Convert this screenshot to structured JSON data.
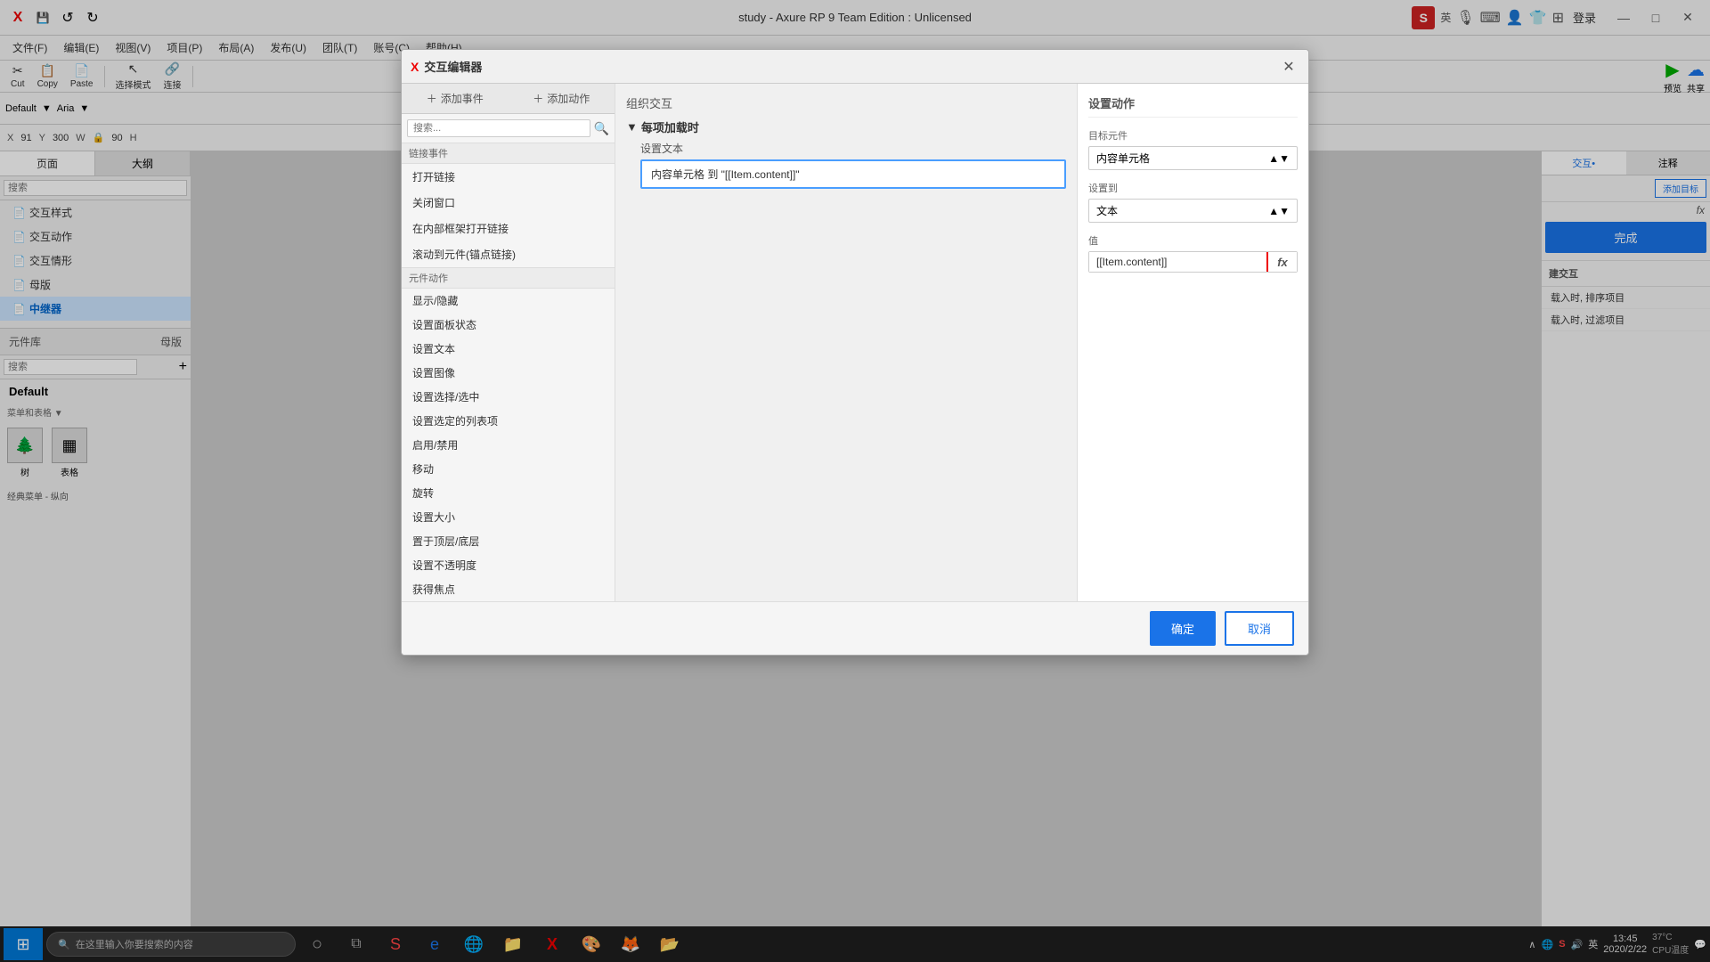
{
  "app": {
    "title": "study - Axure RP 9 Team Edition : Unlicensed",
    "title_icon": "X"
  },
  "titlebar": {
    "save_icon": "💾",
    "undo_icon": "↺",
    "redo_icon": "↻",
    "close_btn": "✕",
    "maximize_btn": "□",
    "minimize_btn": "—"
  },
  "menubar": {
    "items": [
      {
        "label": "文件(F)"
      },
      {
        "label": "编辑(E)"
      },
      {
        "label": "视图(V)"
      },
      {
        "label": "项目(P)"
      },
      {
        "label": "布局(A)"
      },
      {
        "label": "发布(U)"
      },
      {
        "label": "团队(T)"
      },
      {
        "label": "账号(C)"
      },
      {
        "label": "帮助(H)"
      }
    ]
  },
  "toolbar": {
    "cut_label": "Cut",
    "copy_label": "Copy",
    "paste_label": "Paste",
    "select_mode_label": "选择模式",
    "connect_label": "连接"
  },
  "format_bar": {
    "font": "Default",
    "font_face": "Aria"
  },
  "property_bar": {
    "x": "91",
    "y": "300",
    "w": "90",
    "h": ""
  },
  "left_panel": {
    "tab1": "页面",
    "tab2": "大纲",
    "items": [
      {
        "label": "交互样式"
      },
      {
        "label": "交互动作"
      },
      {
        "label": "交互情形"
      },
      {
        "label": "母版"
      },
      {
        "label": "中继器",
        "active": true
      }
    ],
    "library_title": "元件库",
    "library_subtitle": "母版",
    "default_label": "Default",
    "tree_label": "树",
    "table_label": "表格",
    "classic_menu_label": "经典菜单 - 纵向"
  },
  "right_panel": {
    "tab_interact": "交互•",
    "tab_notes": "注释",
    "interact_section": "建交互",
    "sort_label": "载入时, 排序项目",
    "filter_label": "载入时, 过滤项目",
    "complete_btn": "完成",
    "add_target_btn": "添加目标",
    "fx_icon": "fx"
  },
  "dialog": {
    "title": "交互编辑器",
    "title_icon": "X",
    "close_btn": "✕",
    "tab_add_event": "添加事件",
    "tab_add_action": "添加动作",
    "search_placeholder": "搜索...",
    "event_section_label": "链接事件",
    "events": [
      {
        "label": "打开链接"
      },
      {
        "label": "关闭窗口"
      },
      {
        "label": "在内部框架打开链接"
      },
      {
        "label": "滚动到元件(锚点链接)"
      }
    ],
    "action_section_label": "元件动作",
    "actions": [
      {
        "label": "显示/隐藏"
      },
      {
        "label": "设置面板状态"
      },
      {
        "label": "设置文本"
      },
      {
        "label": "设置图像"
      },
      {
        "label": "设置选择/选中"
      },
      {
        "label": "设置选定的列表项"
      },
      {
        "label": "启用/禁用"
      },
      {
        "label": "移动"
      },
      {
        "label": "旋转"
      },
      {
        "label": "设置大小"
      },
      {
        "label": "置于顶层/底层"
      },
      {
        "label": "设置不透明度"
      },
      {
        "label": "获得焦点"
      }
    ],
    "middle_title": "组织交互",
    "event_header": "每项加载时",
    "action_label": "设置文本",
    "action_item_text": "内容单元格 到 \"[[Item.content]]\"",
    "right_title": "设置动作",
    "target_label": "目标元件",
    "target_value": "内容单元格",
    "set_to_label": "设置到",
    "set_to_value": "文本",
    "value_label": "值",
    "value_text": "[[Item.content]]",
    "confirm_btn": "确定",
    "cancel_btn": "取消"
  },
  "taskbar": {
    "search_placeholder": "在这里输入你要搜索的内容",
    "time": "13:45",
    "date": "2020/2/22",
    "cpu_temp": "37°C",
    "cpu_label": "CPU温度",
    "lang": "英"
  }
}
